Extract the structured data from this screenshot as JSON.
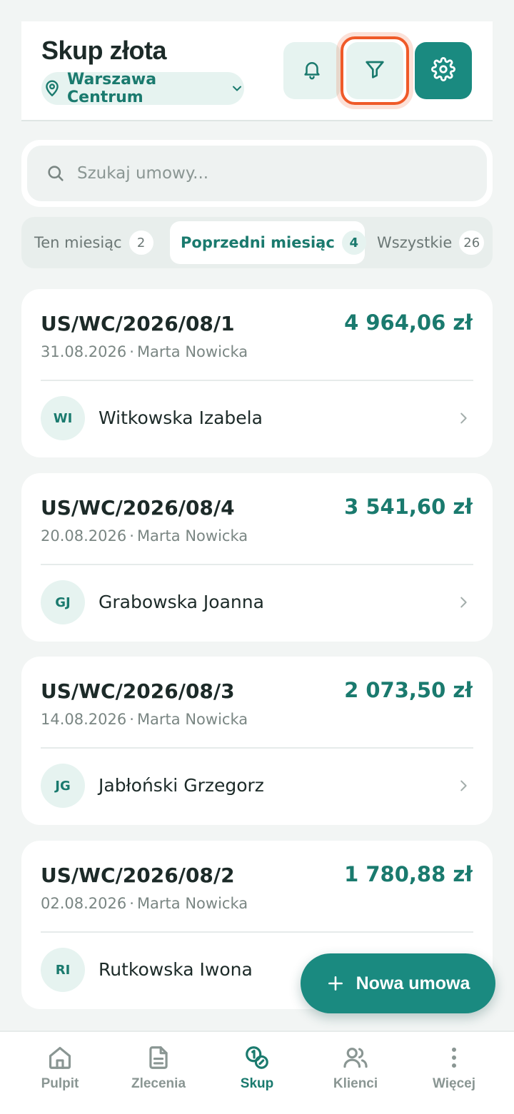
{
  "header": {
    "title": "Skup złota",
    "location": "Warszawa Centrum"
  },
  "search": {
    "placeholder": "Szukaj umowy..."
  },
  "tabs": [
    {
      "label": "Ten miesiąc",
      "count": "2"
    },
    {
      "label": "Poprzedni miesiąc",
      "count": "4"
    },
    {
      "label": "Wszystkie",
      "count": "26"
    }
  ],
  "contracts": [
    {
      "number": "US/WC/2026/08/1",
      "amount": "4 964,06 zł",
      "date": "31.08.2026",
      "employee": "Marta Nowicka",
      "initials": "WI",
      "client": "Witkowska Izabela"
    },
    {
      "number": "US/WC/2026/08/4",
      "amount": "3 541,60 zł",
      "date": "20.08.2026",
      "employee": "Marta Nowicka",
      "initials": "GJ",
      "client": "Grabowska Joanna"
    },
    {
      "number": "US/WC/2026/08/3",
      "amount": "2 073,50 zł",
      "date": "14.08.2026",
      "employee": "Marta Nowicka",
      "initials": "JG",
      "client": "Jabłoński Grzegorz"
    },
    {
      "number": "US/WC/2026/08/2",
      "amount": "1 780,88 zł",
      "date": "02.08.2026",
      "employee": "Marta Nowicka",
      "initials": "RI",
      "client": "Rutkowska Iwona"
    }
  ],
  "meta_separator": "·",
  "fab": {
    "label": "Nowa umowa"
  },
  "nav": [
    {
      "label": "Pulpit",
      "icon": "home-icon"
    },
    {
      "label": "Zlecenia",
      "icon": "document-icon"
    },
    {
      "label": "Skup",
      "icon": "coins-icon"
    },
    {
      "label": "Klienci",
      "icon": "users-icon"
    },
    {
      "label": "Więcej",
      "icon": "more-vertical-icon"
    }
  ],
  "colors": {
    "accent": "#1a8a80",
    "accent_text": "#1a7a6e",
    "highlight": "#ef5a29",
    "background": "#f2f5f4"
  }
}
